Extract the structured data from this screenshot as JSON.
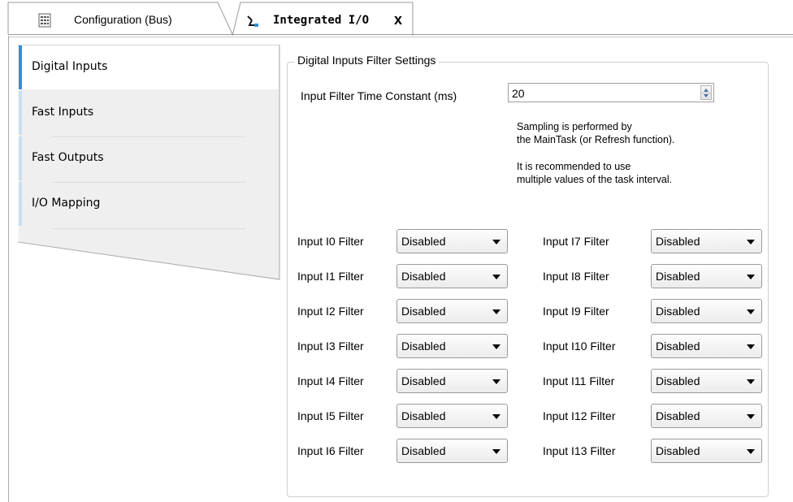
{
  "tabs": [
    {
      "label": "Configuration (Bus)",
      "icon": "grid-document-icon",
      "active": false
    },
    {
      "label": "Integrated I/O",
      "icon": "io-device-icon",
      "active": true,
      "close_glyph": "x"
    }
  ],
  "nav": {
    "accent_color": "#2e8fe0",
    "items": [
      {
        "label": "Digital Inputs",
        "selected": true
      },
      {
        "label": "Fast Inputs",
        "selected": false
      },
      {
        "label": "Fast Outputs",
        "selected": false
      },
      {
        "label": "I/O Mapping",
        "selected": false
      }
    ]
  },
  "panel": {
    "group_title": "Digital Inputs Filter Settings",
    "filter_time": {
      "label": "Input Filter Time Constant (ms)",
      "value": "20"
    },
    "notes": [
      [
        "Sampling is performed by",
        "the MainTask (or Refresh function)."
      ],
      [
        "It is recommended to use",
        "multiple values of the task interval."
      ]
    ]
  },
  "filters": {
    "left": [
      {
        "label": "Input I0 Filter",
        "value": "Disabled"
      },
      {
        "label": "Input I1 Filter",
        "value": "Disabled"
      },
      {
        "label": "Input I2 Filter",
        "value": "Disabled"
      },
      {
        "label": "Input I3 Filter",
        "value": "Disabled"
      },
      {
        "label": "Input I4 Filter",
        "value": "Disabled"
      },
      {
        "label": "Input I5 Filter",
        "value": "Disabled"
      },
      {
        "label": "Input I6 Filter",
        "value": "Disabled"
      }
    ],
    "right": [
      {
        "label": "Input I7 Filter",
        "value": "Disabled"
      },
      {
        "label": "Input I8 Filter",
        "value": "Disabled"
      },
      {
        "label": "Input I9 Filter",
        "value": "Disabled"
      },
      {
        "label": "Input I10 Filter",
        "value": "Disabled"
      },
      {
        "label": "Input I11 Filter",
        "value": "Disabled"
      },
      {
        "label": "Input I12 Filter",
        "value": "Disabled"
      },
      {
        "label": "Input I13 Filter",
        "value": "Disabled"
      }
    ]
  }
}
